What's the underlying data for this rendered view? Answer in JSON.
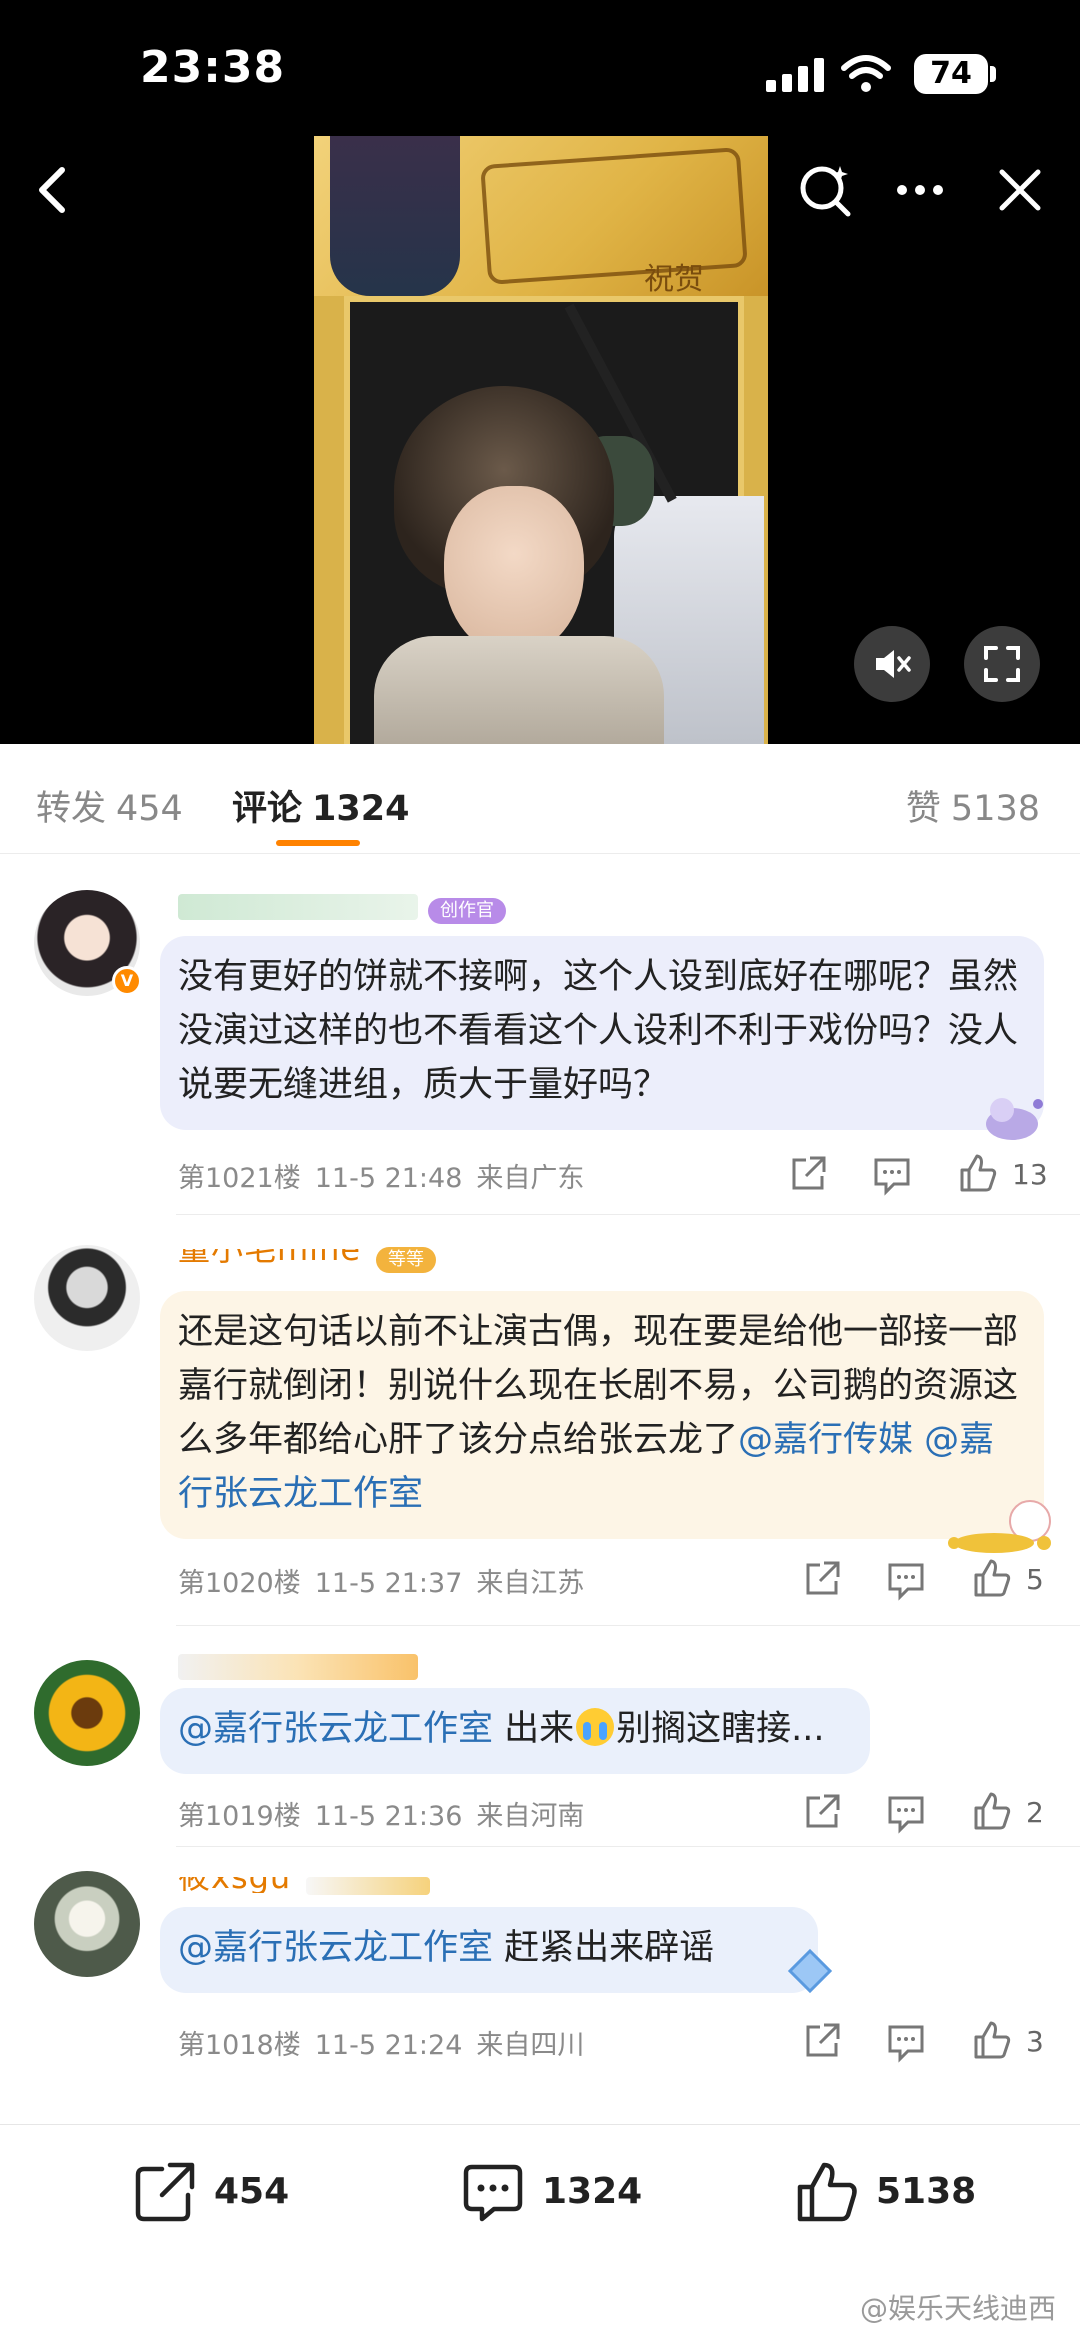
{
  "status_bar": {
    "time": "23:38",
    "battery": "74"
  },
  "tabs": {
    "repost": {
      "label": "转发",
      "count": "454"
    },
    "comment": {
      "label": "评论",
      "count": "1324"
    },
    "like": {
      "label": "赞",
      "count": "5138"
    }
  },
  "comments": [
    {
      "badge": "创作官",
      "text": "没有更好的饼就不接啊，这个人设到底好在哪呢？虽然没演过这样的也不看看这个人设利不利于戏份吗？没人说要无缝进组，质大于量好吗？",
      "floor": "第1021楼",
      "date": "11-5 21:48",
      "location": "来自广东",
      "likes": "13"
    },
    {
      "name": "量小毛mine",
      "badge": "等等",
      "text_plain": "还是这句话以前不让演古偶，现在要是给他一部接一部嘉行就倒闭！别说什么现在长剧不易，公司鹅的资源这么多年都给心肝了该分点给张云龙了",
      "mention_1": "@嘉行传媒",
      "mention_2": "@嘉行张云龙工作室",
      "floor": "第1020楼",
      "date": "11-5 21:37",
      "location": "来自江苏",
      "likes": "5"
    },
    {
      "mention": "@嘉行张云龙工作室",
      "text_a": "出来",
      "text_b": "别搁这瞎接...",
      "floor": "第1019楼",
      "date": "11-5 21:36",
      "location": "来自河南",
      "likes": "2"
    },
    {
      "name": "筱xsgu",
      "mention": "@嘉行张云龙工作室",
      "text": "赶紧出来辟谣",
      "floor": "第1018楼",
      "date": "11-5 21:24",
      "location": "来自四川",
      "likes": "3"
    }
  ],
  "video": {
    "banner_sign": "祝贺"
  },
  "bottom_bar": {
    "repost": "454",
    "comment": "1324",
    "like": "5138"
  },
  "watermark": "@娱乐天线迪西",
  "colors": {
    "accent": "#ff8200",
    "mention": "#2a6fb5"
  }
}
